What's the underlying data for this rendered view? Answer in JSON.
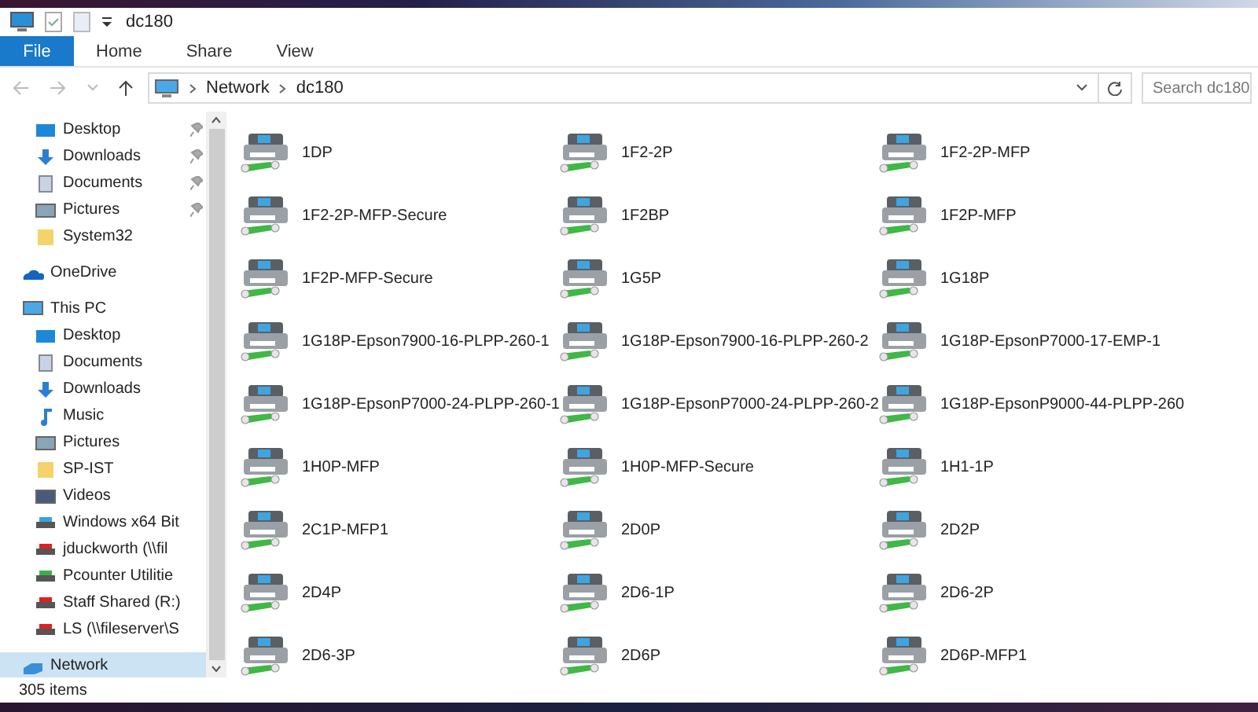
{
  "window": {
    "title": "dc180"
  },
  "ribbon": {
    "tabs": [
      {
        "label": "File",
        "selected": true
      },
      {
        "label": "Home",
        "selected": false
      },
      {
        "label": "Share",
        "selected": false
      },
      {
        "label": "View",
        "selected": false
      }
    ]
  },
  "address_bar": {
    "path": [
      "Network",
      "dc180"
    ],
    "search": {
      "placeholder": "Search dc180"
    }
  },
  "sidebar": {
    "quick_access_items": [
      {
        "label": "Desktop",
        "kind": "desktop",
        "pinned": true,
        "selected": false
      },
      {
        "label": "Downloads",
        "kind": "download",
        "pinned": true,
        "selected": false
      },
      {
        "label": "Documents",
        "kind": "document",
        "pinned": true,
        "selected": false
      },
      {
        "label": "Pictures",
        "kind": "picture",
        "pinned": true,
        "selected": false
      },
      {
        "label": "System32",
        "kind": "folder",
        "pinned": false,
        "selected": false
      }
    ],
    "tree": [
      {
        "label": "OneDrive",
        "kind": "cloud",
        "selected": false
      },
      {
        "label": "This PC",
        "kind": "pc",
        "selected": false,
        "children": [
          {
            "label": "Desktop",
            "kind": "desktop",
            "selected": false
          },
          {
            "label": "Documents",
            "kind": "document",
            "selected": false
          },
          {
            "label": "Downloads",
            "kind": "download",
            "selected": false
          },
          {
            "label": "Music",
            "kind": "music",
            "selected": false
          },
          {
            "label": "Pictures",
            "kind": "picture",
            "selected": false
          },
          {
            "label": "SP-IST",
            "kind": "folder",
            "selected": false
          },
          {
            "label": "Videos",
            "kind": "video",
            "selected": false
          },
          {
            "label": "Windows x64 Bit",
            "kind": "os-drive",
            "selected": false
          },
          {
            "label": "jduckworth (\\\\fil",
            "kind": "drive-disconnected",
            "selected": false
          },
          {
            "label": "Pcounter Utilitie",
            "kind": "drive",
            "selected": false
          },
          {
            "label": "Staff Shared (R:)",
            "kind": "drive-disconnected",
            "selected": false
          },
          {
            "label": "LS (\\\\fileserver\\S",
            "kind": "drive-disconnected",
            "selected": false
          }
        ]
      },
      {
        "label": "Network",
        "kind": "network",
        "selected": true
      }
    ]
  },
  "items": [
    "1DP",
    "1F2-2P",
    "1F2-2P-MFP",
    "1F2-2P-MFP-Secure",
    "1F2BP",
    "1F2P-MFP",
    "1F2P-MFP-Secure",
    "1G5P",
    "1G18P",
    "1G18P-Epson7900-16-PLPP-260-1",
    "1G18P-Epson7900-16-PLPP-260-2",
    "1G18P-EpsonP7000-17-EMP-1",
    "1G18P-EpsonP7000-24-PLPP-260-1",
    "1G18P-EpsonP7000-24-PLPP-260-2",
    "1G18P-EpsonP9000-44-PLPP-260",
    "1H0P-MFP",
    "1H0P-MFP-Secure",
    "1H1-1P",
    "2C1P-MFP1",
    "2D0P",
    "2D2P",
    "2D4P",
    "2D6-1P",
    "2D6-2P",
    "2D6-3P",
    "2D6P",
    "2D6P-MFP1"
  ],
  "status_bar": {
    "count": "305 items"
  }
}
